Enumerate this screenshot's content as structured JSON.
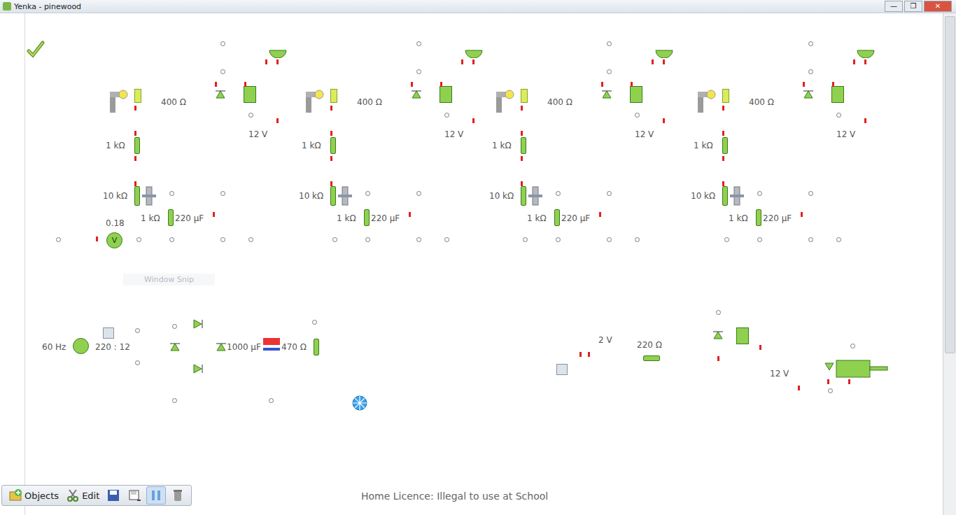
{
  "window": {
    "title": "Yenka - pinewood",
    "controls": [
      "—",
      "❐",
      "✕"
    ]
  },
  "modules": [
    {
      "lamp_resistor": "400 Ω",
      "supply": "12 V",
      "base_resistor": "1 kΩ",
      "pot": "10 kΩ",
      "timer_resistor": "1 kΩ",
      "capacitor": "220 µF"
    },
    {
      "lamp_resistor": "400 Ω",
      "supply": "12 V",
      "base_resistor": "1 kΩ",
      "pot": "10 kΩ",
      "timer_resistor": "1 kΩ",
      "capacitor": "220 µF"
    },
    {
      "lamp_resistor": "400 Ω",
      "supply": "12 V",
      "base_resistor": "1 kΩ",
      "pot": "10 kΩ",
      "timer_resistor": "1 kΩ",
      "capacitor": "220 µF"
    },
    {
      "lamp_resistor": "400 Ω",
      "supply": "12 V",
      "base_resistor": "1 kΩ",
      "pot": "10 kΩ",
      "timer_resistor": "1 kΩ",
      "capacitor": "220 µF"
    }
  ],
  "voltmeter": {
    "reading": "0.18",
    "symbol": "V"
  },
  "watermark": "Window Snip",
  "power_supply": {
    "source": "60 Hz",
    "transformer": "220 : 12",
    "capacitor": "1000 µF",
    "resistor": "470 Ω"
  },
  "motor_circuit": {
    "cell": "2 V",
    "resistor": "220 Ω",
    "supply": "12 V"
  },
  "licence": "Home Licence: Illegal to use at School",
  "toolbar": [
    {
      "label": "Objects",
      "kind": "objects",
      "selected": false
    },
    {
      "label": "Edit",
      "kind": "edit",
      "selected": false
    },
    {
      "kind": "save",
      "selected": false
    },
    {
      "kind": "save-as",
      "selected": false
    },
    {
      "kind": "pause",
      "selected": true
    },
    {
      "kind": "trash",
      "selected": false
    }
  ]
}
